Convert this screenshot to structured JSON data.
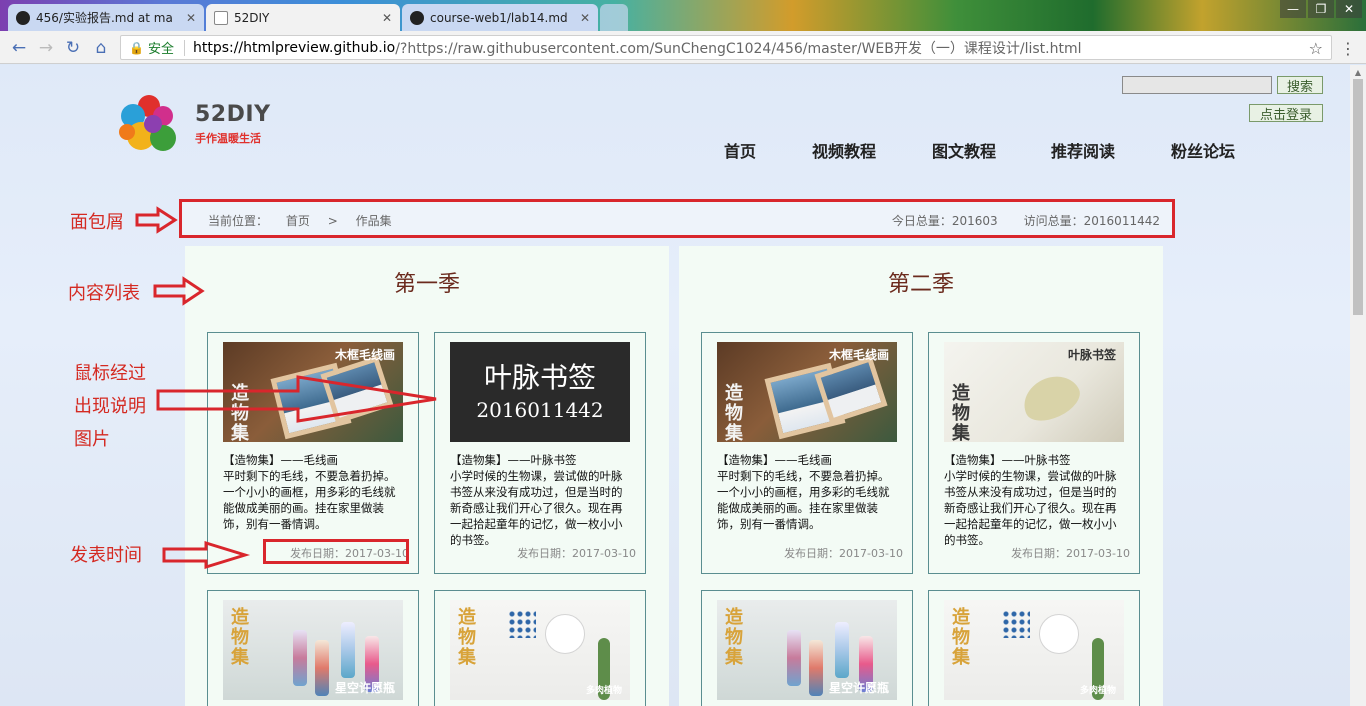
{
  "browser": {
    "tabs": [
      {
        "title": "456/实验报告.md at ma"
      },
      {
        "title": "52DIY"
      },
      {
        "title": "course-web1/lab14.md"
      }
    ],
    "window_controls": [
      "—",
      "❐",
      "✕"
    ],
    "nav": {
      "back": "←",
      "forward": "→",
      "reload": "↻",
      "home": "⌂"
    },
    "address": {
      "lock": "🔒",
      "secure_label": "安全",
      "url_host": "https://htmlpreview.github.io",
      "url_rest": "/?https://raw.githubusercontent.com/SunChengC1024/456/master/WEB开发（一）课程设计/list.html",
      "star": "☆"
    }
  },
  "site": {
    "logo": {
      "title": "52DIY",
      "subtitle": "手作温暖生活"
    },
    "search_button": "搜索",
    "login_button": "点击登录",
    "nav": [
      "首页",
      "视频教程",
      "图文教程",
      "推荐阅读",
      "粉丝论坛"
    ]
  },
  "breadcrumb": {
    "label": "当前位置：",
    "home": "首页",
    "sep": ">",
    "current": "作品集",
    "today": "今日总量：201603",
    "visits": "访问总量：2016011442"
  },
  "seasons": [
    {
      "title": "第一季"
    },
    {
      "title": "第二季"
    }
  ],
  "cards": {
    "yarn": {
      "thumb_label": "木框毛线画",
      "thumb_brand": "造物集",
      "title": "【造物集】——毛线画",
      "desc": "平时剩下的毛线，不要急着扔掉。一个小小的画框，用多彩的毛线就能做成美丽的画。挂在家里做装饰，别有一番情调。",
      "date": "发布日期：2017-03-10"
    },
    "leaf": {
      "thumb_label": "叶脉书签",
      "thumb_brand": "造物集",
      "title": "【造物集】——叶脉书签",
      "desc": "小学时候的生物课，尝试做的叶脉书签从来没有成功过，但是当时的新奇感让我们开心了很久。现在再一起拾起童年的记忆，做一枚小小的书签。",
      "date": "发布日期：2017-03-10"
    },
    "leaf_hover": {
      "overlay_title": "叶脉书签",
      "overlay_number": "2016011442"
    },
    "bottle": {
      "thumb_label": "星空许愿瓶",
      "thumb_brand": "造物集"
    },
    "shelf": {
      "thumb_label": "多肉植物",
      "thumb_brand": "造物集"
    }
  },
  "annotations": {
    "breadcrumb": "面包屑",
    "content_list": "内容列表",
    "hover_line1": "鼠标经过",
    "hover_line2": "出现说明",
    "hover_line3": "图片",
    "publish_time": "发表时间"
  },
  "colors": {
    "annotation_red": "#d9262c",
    "card_border": "#5a8e90",
    "season_title": "#6b2a1d"
  }
}
